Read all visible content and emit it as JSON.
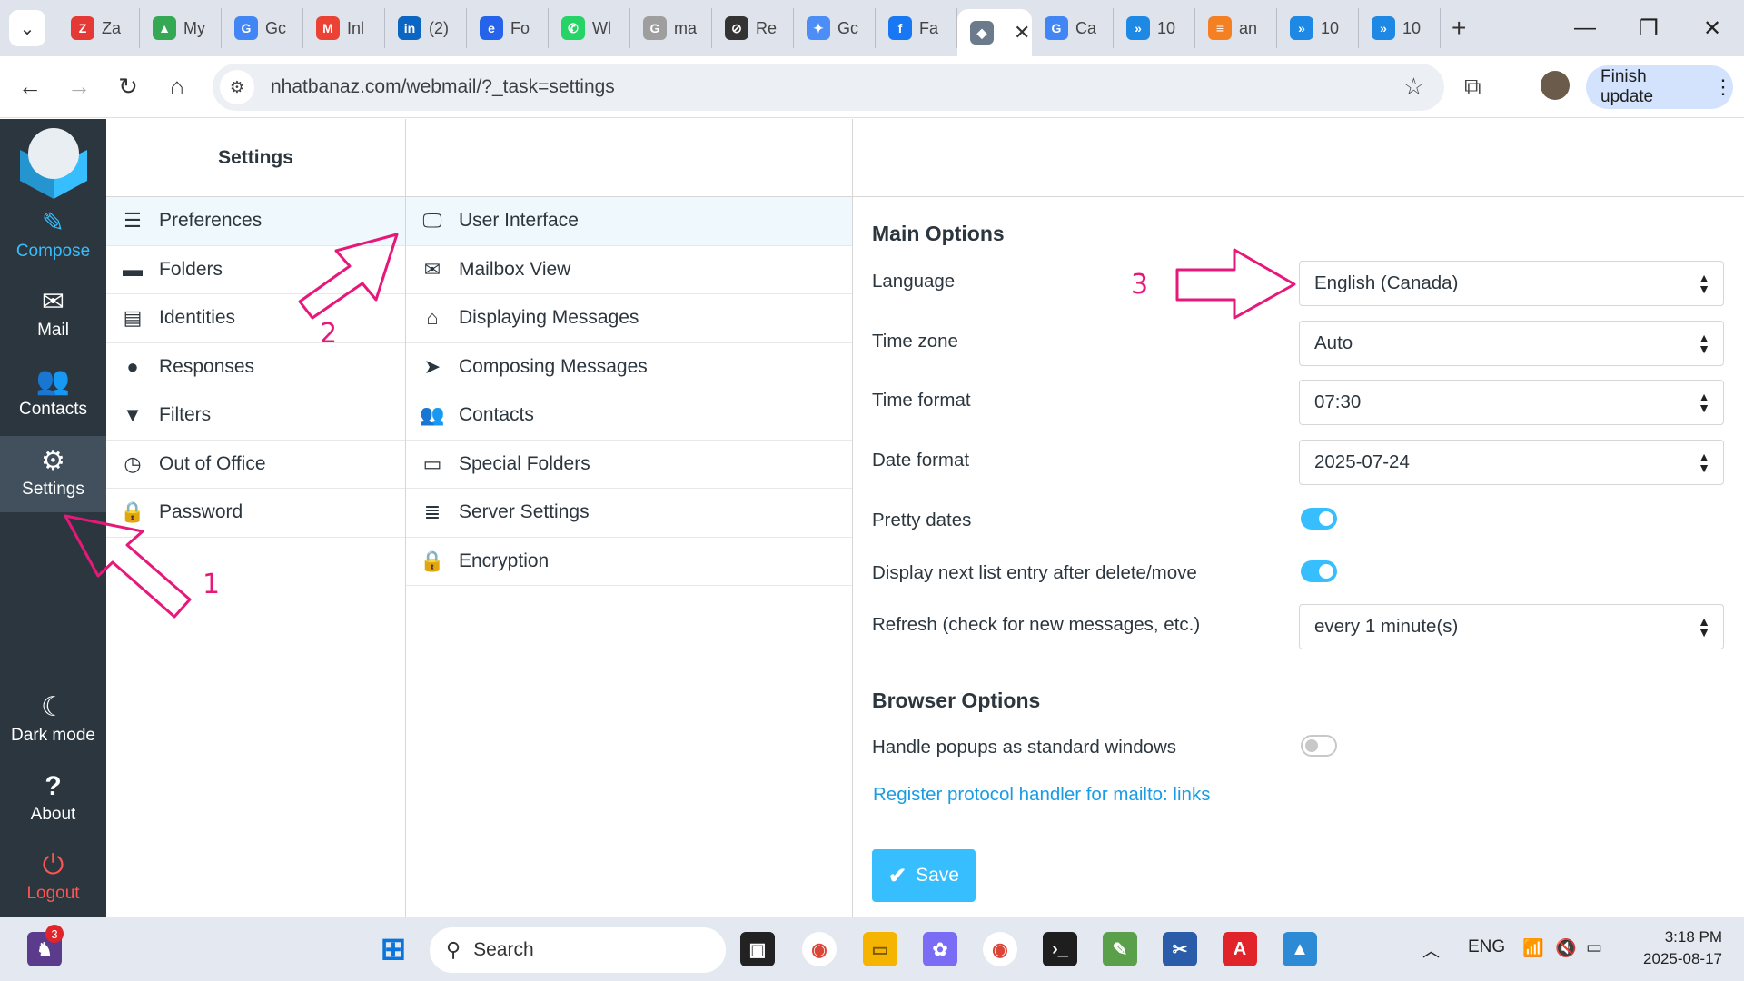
{
  "browser": {
    "tabs": [
      {
        "title": "Za",
        "icon": "zalo-icon",
        "color": "#e53935",
        "glyph": "Z"
      },
      {
        "title": "My",
        "icon": "drive-icon",
        "color": "#34a853",
        "glyph": "▲"
      },
      {
        "title": "Gc",
        "icon": "translate-icon",
        "color": "#4285f4",
        "glyph": "G"
      },
      {
        "title": "Inl",
        "icon": "gmail-icon",
        "color": "#ea4335",
        "glyph": "M"
      },
      {
        "title": "(2)",
        "icon": "linkedin-icon",
        "color": "#0a66c2",
        "glyph": "in"
      },
      {
        "title": "Fo",
        "icon": "form-icon",
        "color": "#2563eb",
        "glyph": "e"
      },
      {
        "title": "Wl",
        "icon": "whatsapp-icon",
        "color": "#25d366",
        "glyph": "✆"
      },
      {
        "title": "ma",
        "icon": "google-icon",
        "color": "#9e9e9e",
        "glyph": "G"
      },
      {
        "title": "Re",
        "icon": "openai-icon",
        "color": "#333333",
        "glyph": "⊘"
      },
      {
        "title": "Gc",
        "icon": "gemini-icon",
        "color": "#4c8df6",
        "glyph": "✦"
      },
      {
        "title": "Fa",
        "icon": "facebook-icon",
        "color": "#1877f2",
        "glyph": "f"
      },
      {
        "title": "",
        "icon": "roundcube-icon",
        "color": "#6b7b8c",
        "glyph": "◆",
        "active": true
      },
      {
        "title": "Ca",
        "icon": "google-icon",
        "color": "#4285f4",
        "glyph": "G"
      },
      {
        "title": "10",
        "icon": "copilot-icon",
        "color": "#1e88e5",
        "glyph": "»"
      },
      {
        "title": "an",
        "icon": "stackoverflow-icon",
        "color": "#f48024",
        "glyph": "≡"
      },
      {
        "title": "10",
        "icon": "copilot-icon",
        "color": "#1e88e5",
        "glyph": "»"
      },
      {
        "title": "10",
        "icon": "copilot-icon",
        "color": "#1e88e5",
        "glyph": "»"
      }
    ],
    "url": "nhatbanaz.com/webmail/?_task=settings",
    "finish_update": "Finish update"
  },
  "nav": {
    "items": [
      {
        "label": "Compose",
        "icon": "compose-icon"
      },
      {
        "label": "Mail",
        "icon": "mail-icon"
      },
      {
        "label": "Contacts",
        "icon": "contacts-icon"
      },
      {
        "label": "Settings",
        "icon": "gear-icon"
      },
      {
        "label": "Dark mode",
        "icon": "moon-icon"
      },
      {
        "label": "About",
        "icon": "question-icon"
      },
      {
        "label": "Logout",
        "icon": "power-icon"
      }
    ]
  },
  "settings": {
    "title": "Settings",
    "sections": [
      {
        "label": "Preferences",
        "icon": "sliders-icon"
      },
      {
        "label": "Folders",
        "icon": "folder-icon"
      },
      {
        "label": "Identities",
        "icon": "id-card-icon"
      },
      {
        "label": "Responses",
        "icon": "comment-icon"
      },
      {
        "label": "Filters",
        "icon": "filter-icon"
      },
      {
        "label": "Out of Office",
        "icon": "clock-icon"
      },
      {
        "label": "Password",
        "icon": "lock-icon"
      }
    ]
  },
  "preferences": {
    "items": [
      {
        "label": "User Interface",
        "icon": "monitor-icon"
      },
      {
        "label": "Mailbox View",
        "icon": "envelope-icon"
      },
      {
        "label": "Displaying Messages",
        "icon": "inbox-icon"
      },
      {
        "label": "Composing Messages",
        "icon": "send-icon"
      },
      {
        "label": "Contacts",
        "icon": "users-icon"
      },
      {
        "label": "Special Folders",
        "icon": "folder-open-icon"
      },
      {
        "label": "Server Settings",
        "icon": "server-icon"
      },
      {
        "label": "Encryption",
        "icon": "lock-icon"
      }
    ]
  },
  "form": {
    "main_options": "Main Options",
    "language_label": "Language",
    "language_value": "English (Canada)",
    "timezone_label": "Time zone",
    "timezone_value": "Auto",
    "timeformat_label": "Time format",
    "timeformat_value": "07:30",
    "dateformat_label": "Date format",
    "dateformat_value": "2025-07-24",
    "prettydates_label": "Pretty dates",
    "prettydates_on": true,
    "displaynext_label": "Display next list entry after delete/move",
    "displaynext_on": true,
    "refresh_label": "Refresh (check for new messages, etc.)",
    "refresh_value": "every 1 minute(s)",
    "browser_options": "Browser Options",
    "popups_label": "Handle popups as standard windows",
    "popups_on": false,
    "protocol_link": "Register protocol handler for mailto: links",
    "save": "Save"
  },
  "annotations": {
    "one": "1",
    "two": "2",
    "three": "3",
    "color": "#e6187a"
  },
  "taskbar": {
    "search_placeholder": "Search",
    "notification_count": "3",
    "lang": "ENG",
    "time": "3:18 PM",
    "date": "2025-08-17"
  }
}
